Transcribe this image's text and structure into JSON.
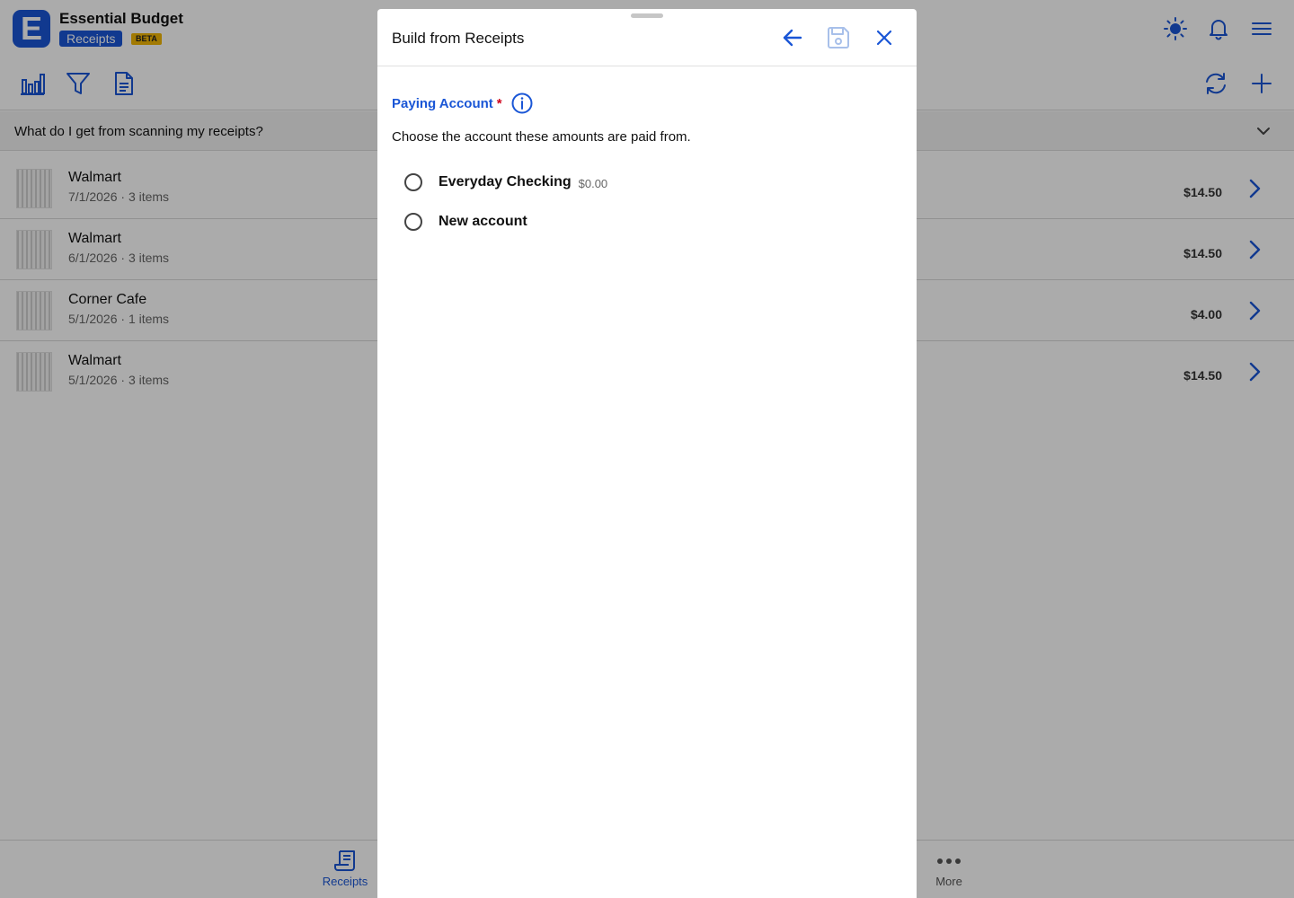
{
  "app": {
    "logo_letter": "E",
    "title": "Essential Budget",
    "module_badge": "Receipts",
    "beta_badge": "BETA",
    "faq_text": "What do I get from scanning my receipts?"
  },
  "receipts": [
    {
      "merchant": "Walmart",
      "meta": "7/1/2026 · 3 items",
      "amount": "$14.50"
    },
    {
      "merchant": "Walmart",
      "meta": "6/1/2026 · 3 items",
      "amount": "$14.50"
    },
    {
      "merchant": "Corner Cafe",
      "meta": "5/1/2026 · 1 items",
      "amount": "$4.00"
    },
    {
      "merchant": "Walmart",
      "meta": "5/1/2026 · 3 items",
      "amount": "$14.50"
    }
  ],
  "bottom_nav": {
    "receipts_label": "Receipts",
    "more_label": "More"
  },
  "modal": {
    "title": "Build from Receipts",
    "field_label": "Paying Account",
    "required_marker": "*",
    "help_text": "Choose the account these amounts are paid from.",
    "options": [
      {
        "label": "Everyday Checking",
        "balance": "$0.00",
        "selected": false
      },
      {
        "label": "New account",
        "selected": false
      }
    ]
  },
  "colors": {
    "accent": "#1a56d6",
    "beta": "#f2b705",
    "required": "#d0021b",
    "disabled_icon": "#a8c0ea"
  },
  "icons": {
    "header": [
      "sun-icon",
      "bell-icon",
      "menu-icon"
    ],
    "toolbar": [
      "bar-chart-icon",
      "filter-icon",
      "document-icon",
      "refresh-icon",
      "plus-icon"
    ],
    "modal": [
      "arrow-left-icon",
      "save-icon",
      "close-icon",
      "info-icon"
    ]
  }
}
